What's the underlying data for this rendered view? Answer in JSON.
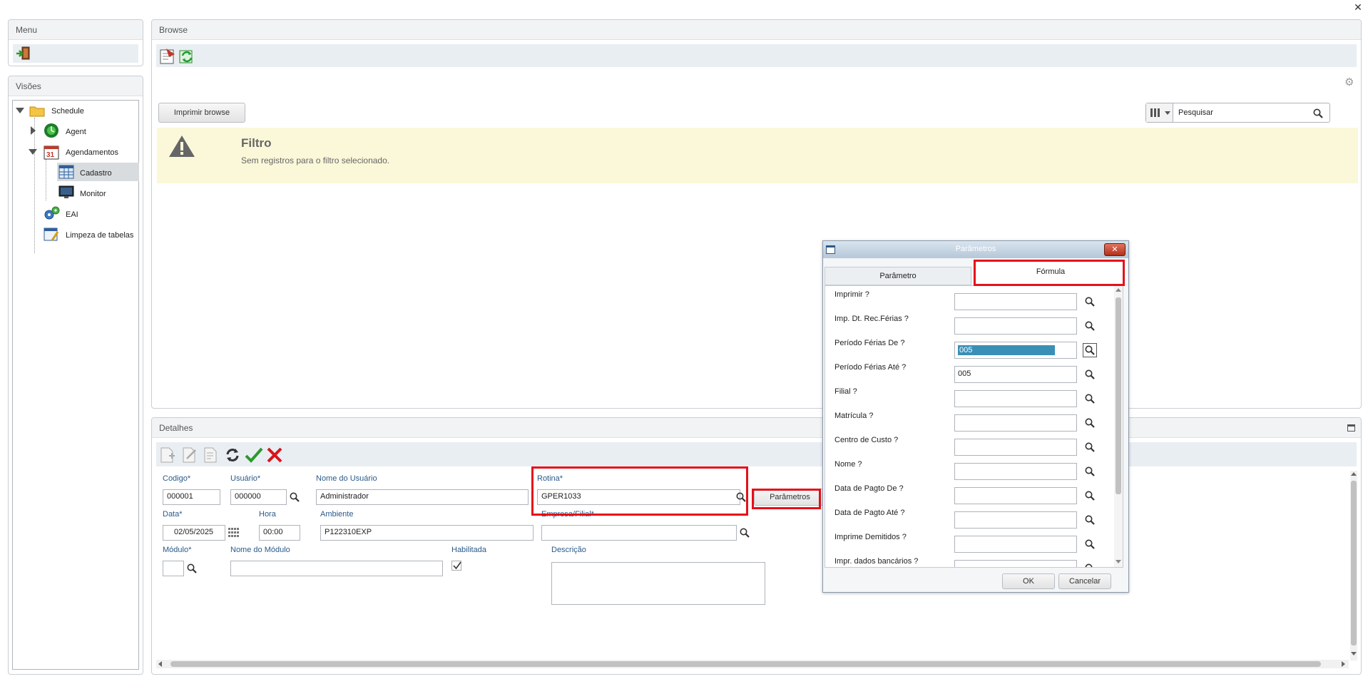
{
  "menu": {
    "title": "Menu"
  },
  "views": {
    "title": "Visões",
    "tree": [
      {
        "label": "Schedule"
      },
      {
        "label": "Agent"
      },
      {
        "label": "Agendamentos"
      },
      {
        "label": "Cadastro"
      },
      {
        "label": "Monitor"
      },
      {
        "label": "EAI"
      },
      {
        "label": "Limpeza de tabelas"
      }
    ]
  },
  "browse": {
    "title": "Browse",
    "print_button": "Imprimir browse",
    "search_placeholder": "Pesquisar",
    "filter_title": "Filtro",
    "filter_message": "Sem registros para o filtro selecionado."
  },
  "details": {
    "title": "Detalhes",
    "fields": {
      "codigo": {
        "label": "Codigo*",
        "value": "000001"
      },
      "usuario": {
        "label": "Usuário*",
        "value": "000000"
      },
      "nome_usuario": {
        "label": "Nome do Usuário",
        "value": "Administrador"
      },
      "rotina": {
        "label": "Rotina*",
        "value": "GPER1033"
      },
      "parametros_button": "Parâmetros",
      "data": {
        "label": "Data*",
        "value": "02/05/2025"
      },
      "hora": {
        "label": "Hora",
        "value": "00:00"
      },
      "ambiente": {
        "label": "Ambiente",
        "value": "P122310EXP"
      },
      "empresa_filial": {
        "label": "Empresa/Filial*",
        "value": ""
      },
      "modulo": {
        "label": "Módulo*",
        "value": ""
      },
      "nome_modulo": {
        "label": "Nome do Módulo",
        "value": ""
      },
      "habilitada": {
        "label": "Habilitada",
        "checked": true
      },
      "descricao": {
        "label": "Descrição",
        "value": ""
      }
    }
  },
  "dialog": {
    "title": "Parâmetros",
    "tabs": [
      {
        "label": "Parâmetro"
      },
      {
        "label": "Fórmula"
      }
    ],
    "active_tab": "Fórmula",
    "rows": [
      {
        "label": "Imprimir ?",
        "value": ""
      },
      {
        "label": "Imp. Dt. Rec.Férias ?",
        "value": ""
      },
      {
        "label": "Período Férias De ?",
        "value": "005"
      },
      {
        "label": "Período Férias Até ?",
        "value": "005"
      },
      {
        "label": "Filial ?",
        "value": ""
      },
      {
        "label": "Matrícula ?",
        "value": ""
      },
      {
        "label": "Centro de Custo ?",
        "value": ""
      },
      {
        "label": "Nome ?",
        "value": ""
      },
      {
        "label": "Data de Pagto De ?",
        "value": ""
      },
      {
        "label": "Data de Pagto Até ?",
        "value": ""
      },
      {
        "label": "Imprime Demitidos ?",
        "value": ""
      },
      {
        "label": "Impr. dados bancários ?",
        "value": ""
      }
    ],
    "ok_button": "OK",
    "cancel_button": "Cancelar"
  },
  "colors": {
    "accent_red": "#e5101a",
    "selection": "#3a8fb7",
    "filter_bg": "#fbf8d9"
  }
}
